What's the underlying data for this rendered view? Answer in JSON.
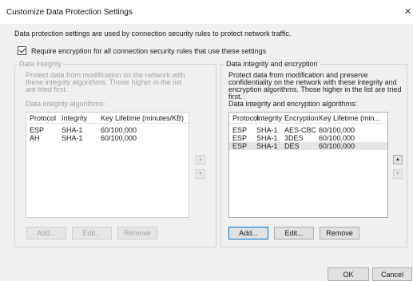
{
  "window": {
    "title": "Customize Data Protection Settings",
    "close_glyph": "✕"
  },
  "description": "Data protection settings are used by connection security rules to protect network traffic.",
  "require_encryption": {
    "label": "Require encryption for all connection security rules that use these settings",
    "checked": true
  },
  "integrity_group": {
    "title": "Data integrity",
    "description": "Protect data from modification on the network with these integrity algorithms. Those higher in the list are tried first.",
    "list_label": "Data integrity algorithms:",
    "columns": [
      "Protocol",
      "Integrity",
      "Key Lifetime (minutes/KB)"
    ],
    "rows": [
      [
        "ESP",
        "SHA-1",
        "60/100,000"
      ],
      [
        "AH",
        "SHA-1",
        "60/100,000"
      ]
    ],
    "buttons": {
      "add": "Add...",
      "edit": "Edit...",
      "remove": "Remove"
    }
  },
  "encryption_group": {
    "title": "Data integrity and encryption",
    "description": "Protect data from modification and preserve confidentiality on the network with these integrity and encryption algorithms.  Those higher in the list are tried first.",
    "list_label": "Data integrity and encryption algorithms:",
    "columns": [
      "Protocol",
      "Integrity",
      "Encryption",
      "Key Lifetime (min..."
    ],
    "rows": [
      [
        "ESP",
        "SHA-1",
        "AES-CBC ...",
        "60/100,000"
      ],
      [
        "ESP",
        "SHA-1",
        "3DES",
        "60/100,000"
      ],
      [
        "ESP",
        "SHA-1",
        "DES",
        "60/100,000"
      ]
    ],
    "selected_row": 2,
    "buttons": {
      "add": "Add...",
      "edit": "Edit...",
      "remove": "Remove"
    }
  },
  "footer": {
    "ok": "OK",
    "cancel": "Cancel"
  },
  "icons": {
    "move_up": "move-up-icon",
    "move_down": "move-down-icon"
  }
}
